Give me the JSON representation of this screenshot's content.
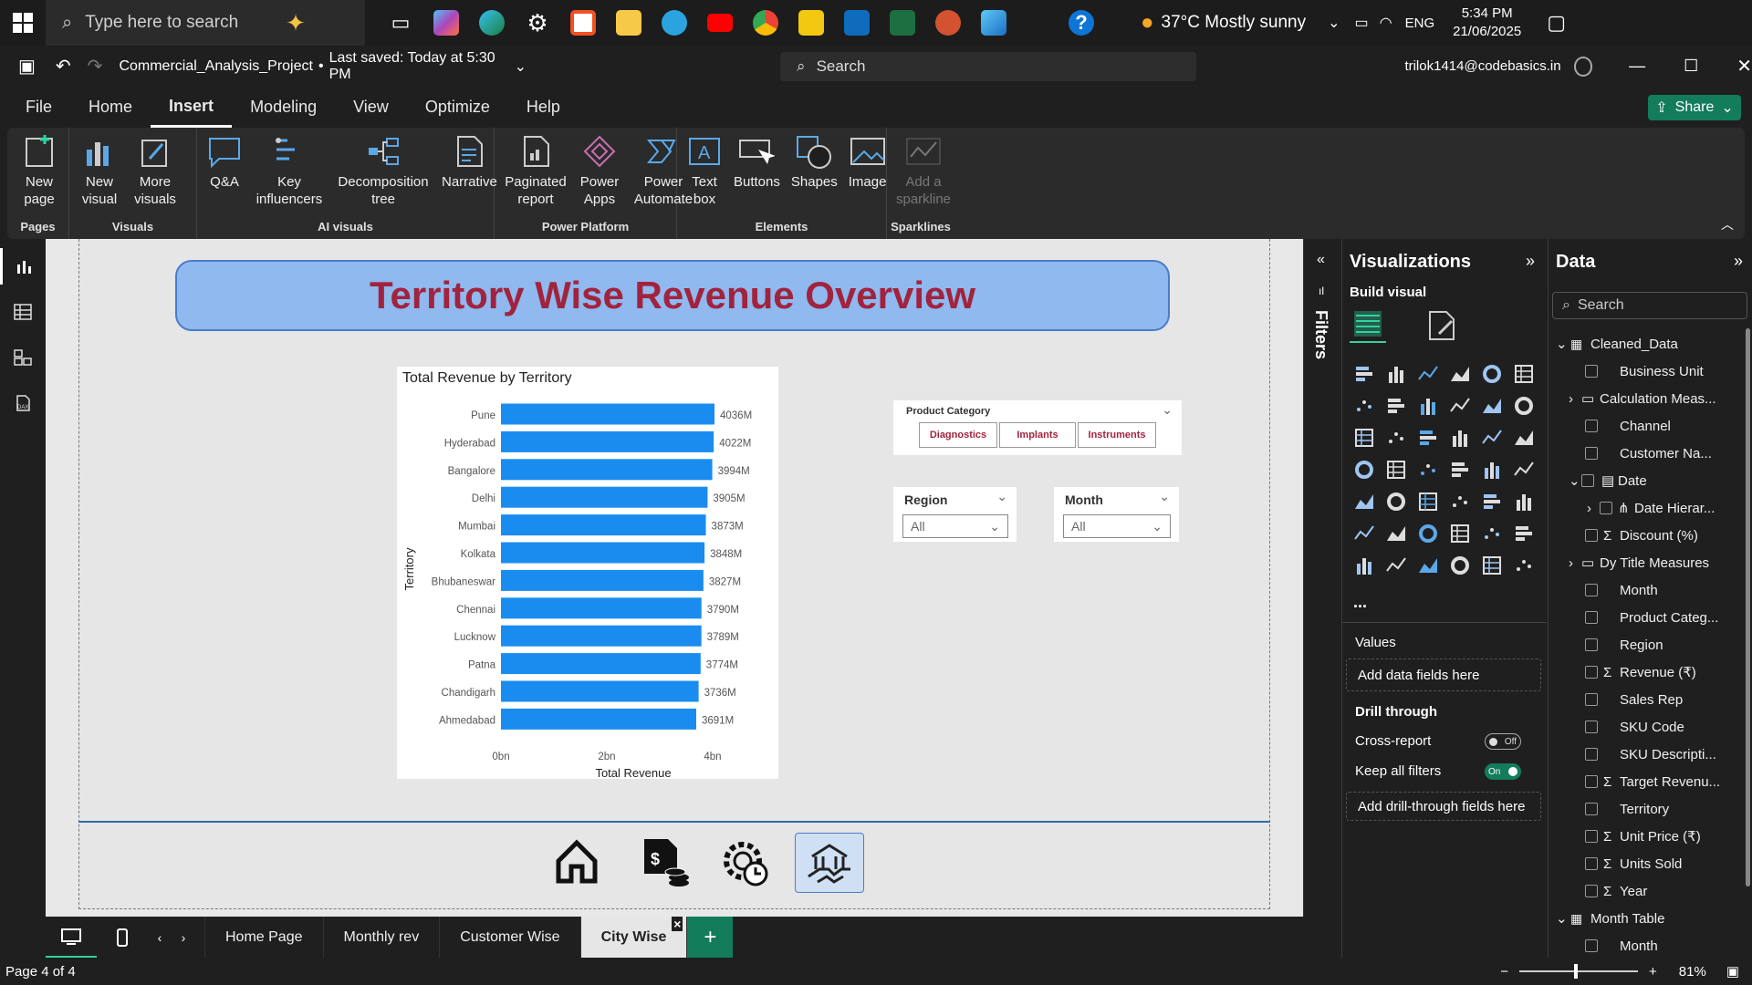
{
  "taskbar": {
    "search_placeholder": "Type here to search",
    "weather": "37°C  Mostly sunny",
    "lang": "ENG",
    "time": "5:34 PM",
    "date": "21/06/2025"
  },
  "titlebar": {
    "project": "Commercial_Analysis_Project",
    "saved": "Last saved: Today at 5:30 PM",
    "search": "Search",
    "user": "trilok1414@codebasics.in"
  },
  "menu": {
    "file": "File",
    "home": "Home",
    "insert": "Insert",
    "modeling": "Modeling",
    "view": "View",
    "optimize": "Optimize",
    "help": "Help",
    "share": "Share"
  },
  "ribbon": {
    "new_page": "New page",
    "pages": "Pages",
    "new_visual": "New visual",
    "more_visuals": "More visuals",
    "visuals": "Visuals",
    "qa": "Q&A",
    "key_influencers": "Key influencers",
    "decomposition": "Decomposition tree",
    "narrative": "Narrative",
    "ai_visuals": "AI visuals",
    "paginated": "Paginated report",
    "power_apps": "Power Apps",
    "power_automate": "Power Automate",
    "power_platform": "Power Platform",
    "text_box": "Text box",
    "buttons": "Buttons",
    "shapes": "Shapes",
    "image": "Image",
    "elements": "Elements",
    "sparkline": "Add a sparkline",
    "sparklines": "Sparklines"
  },
  "report": {
    "title": "Territory Wise Revenue Overview",
    "product_category_title": "Product Category",
    "categories": [
      "Diagnostics",
      "Implants",
      "Instruments"
    ],
    "region_title": "Region",
    "region_value": "All",
    "month_title": "Month",
    "month_value": "All"
  },
  "chart_data": {
    "type": "bar",
    "title": "Total Revenue by Territory",
    "xlabel": "Total Revenue",
    "ylabel": "Territory",
    "categories": [
      "Pune",
      "Hyderabad",
      "Bangalore",
      "Delhi",
      "Mumbai",
      "Kolkata",
      "Bhubaneswar",
      "Chennai",
      "Lucknow",
      "Patna",
      "Chandigarh",
      "Ahmedabad"
    ],
    "values": [
      4036,
      4022,
      3994,
      3905,
      3873,
      3848,
      3827,
      3790,
      3789,
      3774,
      3736,
      3691
    ],
    "data_labels": [
      "4036M",
      "4022M",
      "3994M",
      "3905M",
      "3873M",
      "3848M",
      "3827M",
      "3790M",
      "3789M",
      "3774M",
      "3736M",
      "3691M"
    ],
    "xticks": [
      "0bn",
      "2bn",
      "4bn"
    ],
    "xlim": [
      0,
      4200
    ],
    "bar_color": "#1a8cf0"
  },
  "filters_label": "Filters",
  "viz": {
    "title": "Visualizations",
    "build": "Build visual",
    "values": "Values",
    "add_data": "Add data fields here",
    "drill": "Drill through",
    "cross_report": "Cross-report",
    "cross_state": "Off",
    "keep_filters": "Keep all filters",
    "keep_state": "On",
    "add_drill": "Add drill-through fields here",
    "more": "..."
  },
  "data": {
    "title": "Data",
    "search": "Search",
    "rows": [
      {
        "label": "Cleaned_Data",
        "kind": "table"
      },
      {
        "label": "Business Unit",
        "kind": "field"
      },
      {
        "label": "Calculation Meas...",
        "kind": "folder"
      },
      {
        "label": "Channel",
        "kind": "field"
      },
      {
        "label": "Customer Na...",
        "kind": "field"
      },
      {
        "label": "Date",
        "kind": "date"
      },
      {
        "label": "Date Hierar...",
        "kind": "hier"
      },
      {
        "label": "Discount (%)",
        "kind": "sum"
      },
      {
        "label": "Dy Title Measures",
        "kind": "folder"
      },
      {
        "label": "Month",
        "kind": "field"
      },
      {
        "label": "Product Categ...",
        "kind": "field"
      },
      {
        "label": "Region",
        "kind": "field"
      },
      {
        "label": "Revenue (₹)",
        "kind": "sum"
      },
      {
        "label": "Sales Rep",
        "kind": "field"
      },
      {
        "label": "SKU Code",
        "kind": "field"
      },
      {
        "label": "SKU Descripti...",
        "kind": "field"
      },
      {
        "label": "Target Revenu...",
        "kind": "sum"
      },
      {
        "label": "Territory",
        "kind": "field"
      },
      {
        "label": "Unit Price (₹)",
        "kind": "sum"
      },
      {
        "label": "Units Sold",
        "kind": "sum"
      },
      {
        "label": "Year",
        "kind": "sum"
      },
      {
        "label": "Month Table",
        "kind": "table2"
      },
      {
        "label": "Month",
        "kind": "field"
      }
    ]
  },
  "tabs": [
    "Home Page",
    "Monthly rev",
    "Customer Wise",
    "City Wise"
  ],
  "active_tab": "City Wise",
  "status": {
    "page": "Page 4 of 4",
    "zoom": "81%"
  }
}
